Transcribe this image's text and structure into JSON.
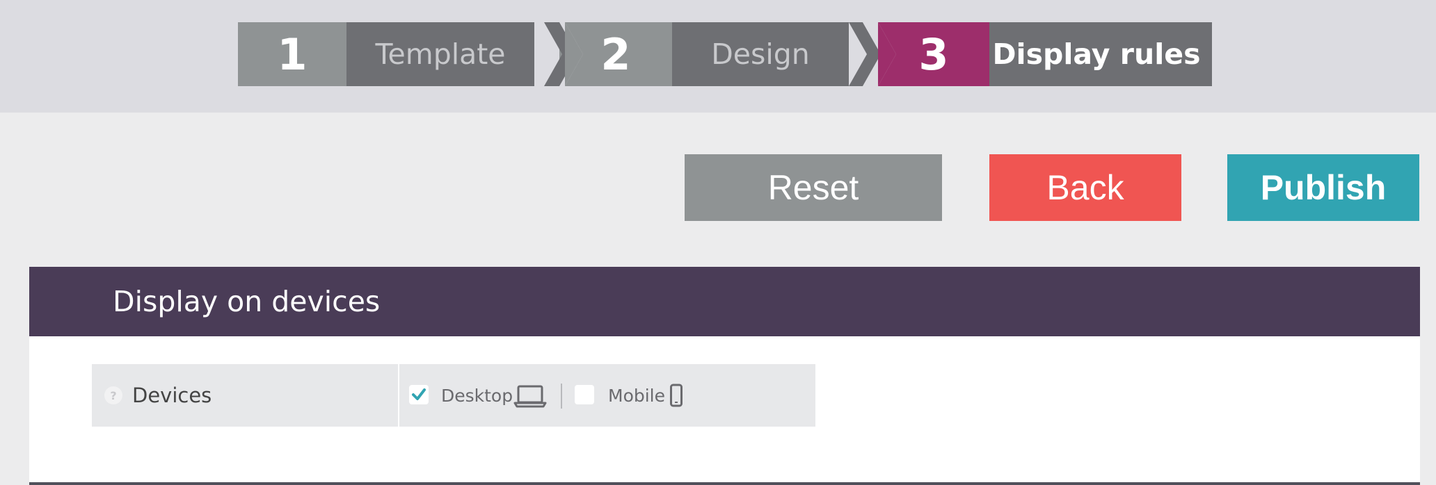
{
  "steps": [
    {
      "number": "1",
      "label": "Template",
      "state": "done"
    },
    {
      "number": "2",
      "label": "Design",
      "state": "done"
    },
    {
      "number": "3",
      "label": "Display rules",
      "state": "active"
    }
  ],
  "colors": {
    "topbar_bg": "#dcdce1",
    "step_inactive_num": "#8f9394",
    "step_label_bg": "#6e6f73",
    "step_active_num": "#9d2e6b",
    "reset": "#8f9394",
    "back": "#f05552",
    "publish": "#31a4b2",
    "panel_header": "#4a3c57",
    "check": "#31a4b2"
  },
  "actions": {
    "reset_label": "Reset",
    "back_label": "Back",
    "publish_label": "Publish"
  },
  "panel": {
    "title": "Display on devices",
    "row": {
      "label": "Devices",
      "help_icon": "?",
      "options": [
        {
          "label": "Desktop",
          "checked": true,
          "icon": "laptop-icon"
        },
        {
          "label": "Mobile",
          "checked": false,
          "icon": "mobile-icon"
        }
      ]
    }
  }
}
